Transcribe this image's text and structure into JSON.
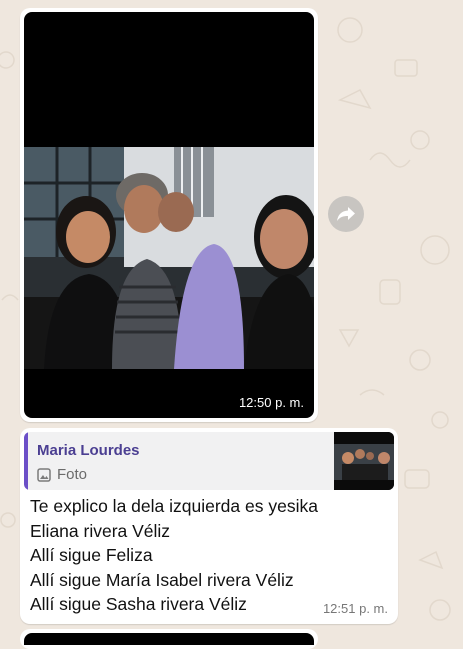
{
  "photo_message": {
    "time": "12:50 p. m."
  },
  "forward_button": {
    "icon": "forward-arrow-icon"
  },
  "reply_message": {
    "quoted": {
      "author": "Maria Lourdes",
      "type_label": "Foto",
      "type_icon": "image-icon",
      "accent_color": "#6b4fc7"
    },
    "lines": [
      "Te explico la dela izquierda es yesika",
      "Eliana rivera Véliz",
      "Allí sigue Feliza",
      "Allí sigue María Isabel rivera Véliz",
      "Allí sigue Sasha rivera Véliz"
    ],
    "time": "12:51 p. m."
  },
  "colors": {
    "chat_background": "#efe7de",
    "bubble": "#ffffff"
  }
}
